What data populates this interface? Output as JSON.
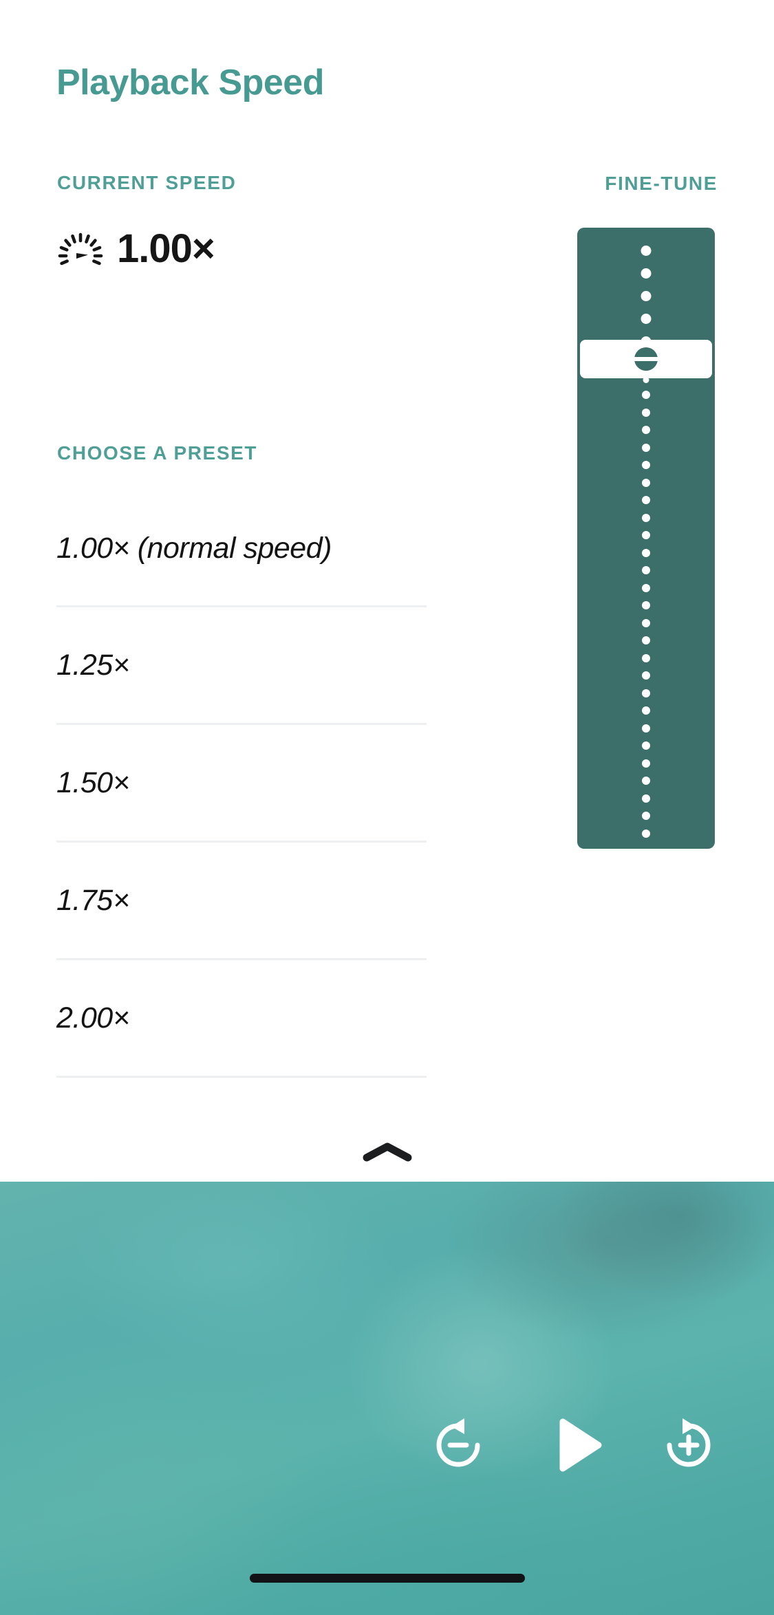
{
  "sheet": {
    "title": "Playback Speed",
    "current_speed": {
      "label": "CURRENT SPEED",
      "icon": "speedometer-icon",
      "value": "1.00×"
    },
    "fine_tune": {
      "label": "FINE-TUNE",
      "icon": "vertical-slider",
      "thumb_grip_icon": "grip-handle-icon",
      "track_color": "#3c6e6a",
      "thumb_color": "#ffffff",
      "thumb_position_percent": 18
    },
    "presets": {
      "label": "CHOOSE A PRESET",
      "items": [
        {
          "label": "1.00× (normal speed)"
        },
        {
          "label": "1.25×"
        },
        {
          "label": "1.50×"
        },
        {
          "label": "1.75×"
        },
        {
          "label": "2.00×"
        }
      ]
    },
    "collapse": {
      "icon": "chevron-up-icon"
    }
  },
  "player": {
    "controls": [
      {
        "name": "rewind-button",
        "icon": "replay-minus-icon"
      },
      {
        "name": "play-button",
        "icon": "play-icon"
      },
      {
        "name": "forward-button",
        "icon": "forward-plus-icon"
      }
    ]
  },
  "colors": {
    "accent_teal": "#479a92",
    "label_teal": "#4f9f97",
    "slider_track": "#3c6e6a",
    "video_teal": "#57aeac",
    "divider": "#edeff1",
    "text_dark": "#141414"
  }
}
